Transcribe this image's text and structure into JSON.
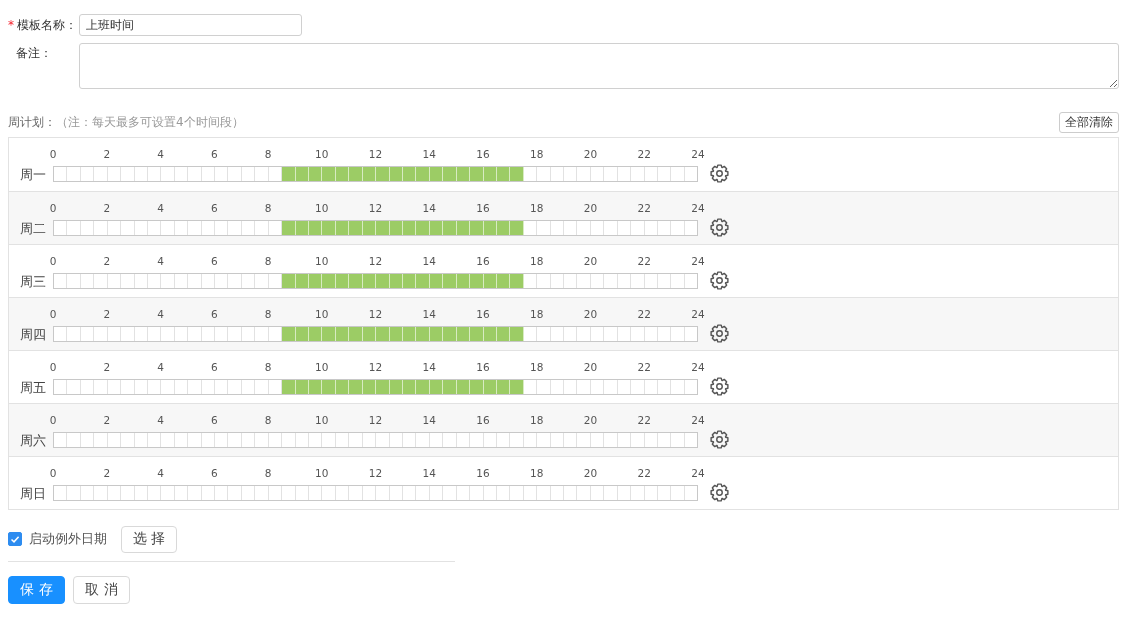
{
  "form": {
    "template_name": {
      "required_mark": "*",
      "label": "模板名称：",
      "value": "上班时间"
    },
    "remark": {
      "label": "备注："
    }
  },
  "week_plan": {
    "label": "周计划：",
    "note": "（注：每天最多可设置4个时间段）",
    "clear_button": "全部清除",
    "days": [
      {
        "label": "周一",
        "ticks": [
          "0",
          "2",
          "4",
          "6",
          "8",
          "10",
          "12",
          "14",
          "16",
          "18",
          "20",
          "22",
          "24"
        ],
        "cells": [
          {
            "selected": false
          },
          {
            "selected": false
          },
          {
            "selected": false
          },
          {
            "selected": false
          },
          {
            "selected": false
          },
          {
            "selected": false
          },
          {
            "selected": false
          },
          {
            "selected": false
          },
          {
            "selected": false
          },
          {
            "selected": false
          },
          {
            "selected": false
          },
          {
            "selected": false
          },
          {
            "selected": false
          },
          {
            "selected": false
          },
          {
            "selected": false
          },
          {
            "selected": false
          },
          {
            "selected": false
          },
          {
            "selected": true
          },
          {
            "selected": true
          },
          {
            "selected": true
          },
          {
            "selected": true
          },
          {
            "selected": true
          },
          {
            "selected": true
          },
          {
            "selected": true
          },
          {
            "selected": true
          },
          {
            "selected": true
          },
          {
            "selected": true
          },
          {
            "selected": true
          },
          {
            "selected": true
          },
          {
            "selected": true
          },
          {
            "selected": true
          },
          {
            "selected": true
          },
          {
            "selected": true
          },
          {
            "selected": true
          },
          {
            "selected": true
          },
          {
            "selected": false
          },
          {
            "selected": false
          },
          {
            "selected": false
          },
          {
            "selected": false
          },
          {
            "selected": false
          },
          {
            "selected": false
          },
          {
            "selected": false
          },
          {
            "selected": false
          },
          {
            "selected": false
          },
          {
            "selected": false
          },
          {
            "selected": false
          },
          {
            "selected": false
          },
          {
            "selected": false
          }
        ]
      },
      {
        "label": "周二",
        "ticks": [
          "0",
          "2",
          "4",
          "6",
          "8",
          "10",
          "12",
          "14",
          "16",
          "18",
          "20",
          "22",
          "24"
        ],
        "cells": [
          {
            "selected": false
          },
          {
            "selected": false
          },
          {
            "selected": false
          },
          {
            "selected": false
          },
          {
            "selected": false
          },
          {
            "selected": false
          },
          {
            "selected": false
          },
          {
            "selected": false
          },
          {
            "selected": false
          },
          {
            "selected": false
          },
          {
            "selected": false
          },
          {
            "selected": false
          },
          {
            "selected": false
          },
          {
            "selected": false
          },
          {
            "selected": false
          },
          {
            "selected": false
          },
          {
            "selected": false
          },
          {
            "selected": true
          },
          {
            "selected": true
          },
          {
            "selected": true
          },
          {
            "selected": true
          },
          {
            "selected": true
          },
          {
            "selected": true
          },
          {
            "selected": true
          },
          {
            "selected": true
          },
          {
            "selected": true
          },
          {
            "selected": true
          },
          {
            "selected": true
          },
          {
            "selected": true
          },
          {
            "selected": true
          },
          {
            "selected": true
          },
          {
            "selected": true
          },
          {
            "selected": true
          },
          {
            "selected": true
          },
          {
            "selected": true
          },
          {
            "selected": false
          },
          {
            "selected": false
          },
          {
            "selected": false
          },
          {
            "selected": false
          },
          {
            "selected": false
          },
          {
            "selected": false
          },
          {
            "selected": false
          },
          {
            "selected": false
          },
          {
            "selected": false
          },
          {
            "selected": false
          },
          {
            "selected": false
          },
          {
            "selected": false
          },
          {
            "selected": false
          }
        ]
      },
      {
        "label": "周三",
        "ticks": [
          "0",
          "2",
          "4",
          "6",
          "8",
          "10",
          "12",
          "14",
          "16",
          "18",
          "20",
          "22",
          "24"
        ],
        "cells": [
          {
            "selected": false
          },
          {
            "selected": false
          },
          {
            "selected": false
          },
          {
            "selected": false
          },
          {
            "selected": false
          },
          {
            "selected": false
          },
          {
            "selected": false
          },
          {
            "selected": false
          },
          {
            "selected": false
          },
          {
            "selected": false
          },
          {
            "selected": false
          },
          {
            "selected": false
          },
          {
            "selected": false
          },
          {
            "selected": false
          },
          {
            "selected": false
          },
          {
            "selected": false
          },
          {
            "selected": false
          },
          {
            "selected": true
          },
          {
            "selected": true
          },
          {
            "selected": true
          },
          {
            "selected": true
          },
          {
            "selected": true
          },
          {
            "selected": true
          },
          {
            "selected": true
          },
          {
            "selected": true
          },
          {
            "selected": true
          },
          {
            "selected": true
          },
          {
            "selected": true
          },
          {
            "selected": true
          },
          {
            "selected": true
          },
          {
            "selected": true
          },
          {
            "selected": true
          },
          {
            "selected": true
          },
          {
            "selected": true
          },
          {
            "selected": true
          },
          {
            "selected": false
          },
          {
            "selected": false
          },
          {
            "selected": false
          },
          {
            "selected": false
          },
          {
            "selected": false
          },
          {
            "selected": false
          },
          {
            "selected": false
          },
          {
            "selected": false
          },
          {
            "selected": false
          },
          {
            "selected": false
          },
          {
            "selected": false
          },
          {
            "selected": false
          },
          {
            "selected": false
          }
        ]
      },
      {
        "label": "周四",
        "ticks": [
          "0",
          "2",
          "4",
          "6",
          "8",
          "10",
          "12",
          "14",
          "16",
          "18",
          "20",
          "22",
          "24"
        ],
        "cells": [
          {
            "selected": false
          },
          {
            "selected": false
          },
          {
            "selected": false
          },
          {
            "selected": false
          },
          {
            "selected": false
          },
          {
            "selected": false
          },
          {
            "selected": false
          },
          {
            "selected": false
          },
          {
            "selected": false
          },
          {
            "selected": false
          },
          {
            "selected": false
          },
          {
            "selected": false
          },
          {
            "selected": false
          },
          {
            "selected": false
          },
          {
            "selected": false
          },
          {
            "selected": false
          },
          {
            "selected": false
          },
          {
            "selected": true
          },
          {
            "selected": true
          },
          {
            "selected": true
          },
          {
            "selected": true
          },
          {
            "selected": true
          },
          {
            "selected": true
          },
          {
            "selected": true
          },
          {
            "selected": true
          },
          {
            "selected": true
          },
          {
            "selected": true
          },
          {
            "selected": true
          },
          {
            "selected": true
          },
          {
            "selected": true
          },
          {
            "selected": true
          },
          {
            "selected": true
          },
          {
            "selected": true
          },
          {
            "selected": true
          },
          {
            "selected": true
          },
          {
            "selected": false
          },
          {
            "selected": false
          },
          {
            "selected": false
          },
          {
            "selected": false
          },
          {
            "selected": false
          },
          {
            "selected": false
          },
          {
            "selected": false
          },
          {
            "selected": false
          },
          {
            "selected": false
          },
          {
            "selected": false
          },
          {
            "selected": false
          },
          {
            "selected": false
          },
          {
            "selected": false
          }
        ]
      },
      {
        "label": "周五",
        "ticks": [
          "0",
          "2",
          "4",
          "6",
          "8",
          "10",
          "12",
          "14",
          "16",
          "18",
          "20",
          "22",
          "24"
        ],
        "cells": [
          {
            "selected": false
          },
          {
            "selected": false
          },
          {
            "selected": false
          },
          {
            "selected": false
          },
          {
            "selected": false
          },
          {
            "selected": false
          },
          {
            "selected": false
          },
          {
            "selected": false
          },
          {
            "selected": false
          },
          {
            "selected": false
          },
          {
            "selected": false
          },
          {
            "selected": false
          },
          {
            "selected": false
          },
          {
            "selected": false
          },
          {
            "selected": false
          },
          {
            "selected": false
          },
          {
            "selected": false
          },
          {
            "selected": true
          },
          {
            "selected": true
          },
          {
            "selected": true
          },
          {
            "selected": true
          },
          {
            "selected": true
          },
          {
            "selected": true
          },
          {
            "selected": true
          },
          {
            "selected": true
          },
          {
            "selected": true
          },
          {
            "selected": true
          },
          {
            "selected": true
          },
          {
            "selected": true
          },
          {
            "selected": true
          },
          {
            "selected": true
          },
          {
            "selected": true
          },
          {
            "selected": true
          },
          {
            "selected": true
          },
          {
            "selected": true
          },
          {
            "selected": false
          },
          {
            "selected": false
          },
          {
            "selected": false
          },
          {
            "selected": false
          },
          {
            "selected": false
          },
          {
            "selected": false
          },
          {
            "selected": false
          },
          {
            "selected": false
          },
          {
            "selected": false
          },
          {
            "selected": false
          },
          {
            "selected": false
          },
          {
            "selected": false
          },
          {
            "selected": false
          }
        ]
      },
      {
        "label": "周六",
        "ticks": [
          "0",
          "2",
          "4",
          "6",
          "8",
          "10",
          "12",
          "14",
          "16",
          "18",
          "20",
          "22",
          "24"
        ],
        "cells": [
          {
            "selected": false
          },
          {
            "selected": false
          },
          {
            "selected": false
          },
          {
            "selected": false
          },
          {
            "selected": false
          },
          {
            "selected": false
          },
          {
            "selected": false
          },
          {
            "selected": false
          },
          {
            "selected": false
          },
          {
            "selected": false
          },
          {
            "selected": false
          },
          {
            "selected": false
          },
          {
            "selected": false
          },
          {
            "selected": false
          },
          {
            "selected": false
          },
          {
            "selected": false
          },
          {
            "selected": false
          },
          {
            "selected": false
          },
          {
            "selected": false
          },
          {
            "selected": false
          },
          {
            "selected": false
          },
          {
            "selected": false
          },
          {
            "selected": false
          },
          {
            "selected": false
          },
          {
            "selected": false
          },
          {
            "selected": false
          },
          {
            "selected": false
          },
          {
            "selected": false
          },
          {
            "selected": false
          },
          {
            "selected": false
          },
          {
            "selected": false
          },
          {
            "selected": false
          },
          {
            "selected": false
          },
          {
            "selected": false
          },
          {
            "selected": false
          },
          {
            "selected": false
          },
          {
            "selected": false
          },
          {
            "selected": false
          },
          {
            "selected": false
          },
          {
            "selected": false
          },
          {
            "selected": false
          },
          {
            "selected": false
          },
          {
            "selected": false
          },
          {
            "selected": false
          },
          {
            "selected": false
          },
          {
            "selected": false
          },
          {
            "selected": false
          },
          {
            "selected": false
          }
        ]
      },
      {
        "label": "周日",
        "ticks": [
          "0",
          "2",
          "4",
          "6",
          "8",
          "10",
          "12",
          "14",
          "16",
          "18",
          "20",
          "22",
          "24"
        ],
        "cells": [
          {
            "selected": false
          },
          {
            "selected": false
          },
          {
            "selected": false
          },
          {
            "selected": false
          },
          {
            "selected": false
          },
          {
            "selected": false
          },
          {
            "selected": false
          },
          {
            "selected": false
          },
          {
            "selected": false
          },
          {
            "selected": false
          },
          {
            "selected": false
          },
          {
            "selected": false
          },
          {
            "selected": false
          },
          {
            "selected": false
          },
          {
            "selected": false
          },
          {
            "selected": false
          },
          {
            "selected": false
          },
          {
            "selected": false
          },
          {
            "selected": false
          },
          {
            "selected": false
          },
          {
            "selected": false
          },
          {
            "selected": false
          },
          {
            "selected": false
          },
          {
            "selected": false
          },
          {
            "selected": false
          },
          {
            "selected": false
          },
          {
            "selected": false
          },
          {
            "selected": false
          },
          {
            "selected": false
          },
          {
            "selected": false
          },
          {
            "selected": false
          },
          {
            "selected": false
          },
          {
            "selected": false
          },
          {
            "selected": false
          },
          {
            "selected": false
          },
          {
            "selected": false
          },
          {
            "selected": false
          },
          {
            "selected": false
          },
          {
            "selected": false
          },
          {
            "selected": false
          },
          {
            "selected": false
          },
          {
            "selected": false
          },
          {
            "selected": false
          },
          {
            "selected": false
          },
          {
            "selected": false
          },
          {
            "selected": false
          },
          {
            "selected": false
          },
          {
            "selected": false
          }
        ]
      }
    ]
  },
  "exception_dates": {
    "checked": true,
    "label": "启动例外日期",
    "button": "选 择"
  },
  "actions": [
    {
      "kind": "primary",
      "label": "保 存"
    },
    {
      "kind": "default",
      "label": "取 消"
    }
  ]
}
